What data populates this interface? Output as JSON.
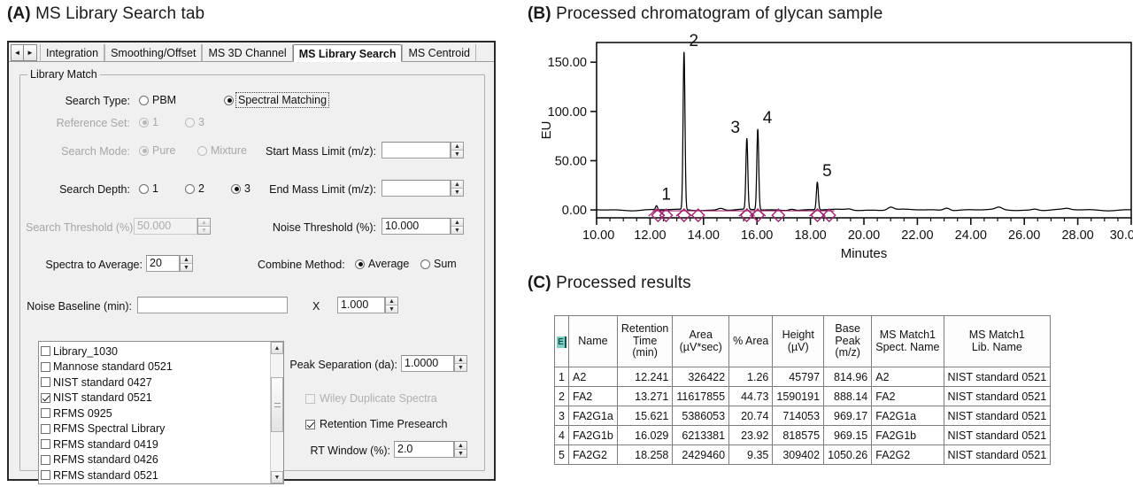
{
  "panels": {
    "a": {
      "tag": "(A)",
      "title": "MS Library Search tab"
    },
    "b": {
      "tag": "(B)",
      "title": "Processed chromatogram of glycan sample"
    },
    "c": {
      "tag": "(C)",
      "title": "Processed results"
    }
  },
  "dialog": {
    "scroll_left_icon": "◄",
    "scroll_right_icon": "►",
    "tabs": [
      {
        "label": "Integration",
        "active": false
      },
      {
        "label": "Smoothing/Offset",
        "active": false
      },
      {
        "label": "MS 3D Channel",
        "active": false
      },
      {
        "label": "MS Library Search",
        "active": true
      },
      {
        "label": "MS Centroid",
        "active": false
      }
    ],
    "groupbox_title": "Library Match",
    "fields": {
      "search_type_label": "Search Type:",
      "search_type_pbm": "PBM",
      "search_type_spectral": "Spectral Matching",
      "reference_set_label": "Reference Set:",
      "reference_set_1": "1",
      "reference_set_3": "3",
      "search_mode_label": "Search Mode:",
      "search_mode_pure": "Pure",
      "search_mode_mixture": "Mixture",
      "search_depth_label": "Search Depth:",
      "search_depth_1": "1",
      "search_depth_2": "2",
      "search_depth_3": "3",
      "search_threshold_label": "Search Threshold (%):",
      "search_threshold_value": "50.000",
      "start_mass_label": "Start Mass Limit (m/z):",
      "start_mass_value": "",
      "end_mass_label": "End Mass Limit (m/z):",
      "end_mass_value": "",
      "noise_threshold_label": "Noise Threshold (%):",
      "noise_threshold_value": "10.000",
      "spectra_average_label": "Spectra to Average:",
      "spectra_average_value": "20",
      "combine_method_label": "Combine Method:",
      "combine_average": "Average",
      "combine_sum": "Sum",
      "noise_baseline_label": "Noise Baseline (min):",
      "noise_baseline_value": "",
      "multiply_symbol": "X",
      "noise_baseline_factor": "1.000",
      "peak_separation_label": "Peak Separation (da):",
      "peak_separation_value": "1.0000",
      "wiley_duplicate_label": "Wiley Duplicate Spectra",
      "retention_presearch_label": "Retention Time Presearch",
      "rt_window_label": "RT Window (%):",
      "rt_window_value": "2.0",
      "spin_up_icon": "▲",
      "spin_down_icon": "▼"
    },
    "libraries": [
      {
        "label": "Library_1030",
        "checked": false
      },
      {
        "label": "Mannose standard 0521",
        "checked": false
      },
      {
        "label": "NIST standard 0427",
        "checked": false
      },
      {
        "label": "NIST standard 0521",
        "checked": true
      },
      {
        "label": "RFMS 0925",
        "checked": false
      },
      {
        "label": "RFMS Spectral Library",
        "checked": false
      },
      {
        "label": "RFMS standard 0419",
        "checked": false
      },
      {
        "label": "RFMS standard 0426",
        "checked": false
      },
      {
        "label": "RFMS standard 0521",
        "checked": false
      }
    ]
  },
  "chart_data": {
    "type": "line",
    "title": "Processed chromatogram of glycan sample",
    "xlabel": "Minutes",
    "ylabel": "EU",
    "xlim": [
      10.0,
      30.0
    ],
    "ylim": [
      -8,
      170
    ],
    "grid": false,
    "legend": "none",
    "xticks": [
      "10.00",
      "12.00",
      "14.00",
      "16.00",
      "18.00",
      "20.00",
      "22.00",
      "24.00",
      "26.00",
      "28.00",
      "30.00"
    ],
    "yticks": [
      "0.00",
      "50.00",
      "100.00",
      "150.00"
    ],
    "peak_marker_color": "#a0246e",
    "trace_color": "#000000",
    "labeled_peaks": [
      {
        "label": "1",
        "x": 12.241,
        "y": 4.0
      },
      {
        "label": "2",
        "x": 13.271,
        "y": 160.0
      },
      {
        "label": "3",
        "x": 15.621,
        "y": 72.0
      },
      {
        "label": "4",
        "x": 16.029,
        "y": 82.0
      },
      {
        "label": "5",
        "x": 18.258,
        "y": 28.0
      }
    ],
    "marker_x": [
      12.3,
      12.6,
      13.27,
      13.8,
      15.62,
      16.03,
      16.8,
      18.26,
      18.7
    ],
    "minor_peaks": [
      {
        "x": 14.65,
        "y": 2.0
      },
      {
        "x": 17.3,
        "y": 1.5
      },
      {
        "x": 19.45,
        "y": 1.2
      },
      {
        "x": 21.0,
        "y": 3.0
      },
      {
        "x": 23.1,
        "y": 2.6
      },
      {
        "x": 25.05,
        "y": 2.2
      },
      {
        "x": 26.4,
        "y": 1.2
      },
      {
        "x": 27.6,
        "y": 1.0
      }
    ]
  },
  "results_table": {
    "corner_icon": "E",
    "columns": [
      {
        "key": "name",
        "header": "Name",
        "align": "txt"
      },
      {
        "key": "rt",
        "header": "Retention\nTime\n(min)",
        "align": "num"
      },
      {
        "key": "area",
        "header": "Area\n(µV*sec)",
        "align": "num"
      },
      {
        "key": "parea",
        "header": "% Area",
        "align": "num"
      },
      {
        "key": "height",
        "header": "Height\n(µV)",
        "align": "num"
      },
      {
        "key": "basepk",
        "header": "Base\nPeak\n(m/z)",
        "align": "num"
      },
      {
        "key": "spect",
        "header": "MS Match1\nSpect. Name",
        "align": "txt"
      },
      {
        "key": "lib",
        "header": "MS Match1\nLib. Name",
        "align": "txt"
      }
    ],
    "rows": [
      {
        "no": "1",
        "name": "A2",
        "rt": "12.241",
        "area": "326422",
        "parea": "1.26",
        "height": "45797",
        "basepk": "814.96",
        "spect": "A2",
        "lib": "NIST standard 0521"
      },
      {
        "no": "2",
        "name": "FA2",
        "rt": "13.271",
        "area": "11617855",
        "parea": "44.73",
        "height": "1590191",
        "basepk": "888.14",
        "spect": "FA2",
        "lib": "NIST standard 0521"
      },
      {
        "no": "3",
        "name": "FA2G1a",
        "rt": "15.621",
        "area": "5386053",
        "parea": "20.74",
        "height": "714053",
        "basepk": "969.17",
        "spect": "FA2G1a",
        "lib": "NIST standard 0521"
      },
      {
        "no": "4",
        "name": "FA2G1b",
        "rt": "16.029",
        "area": "6213381",
        "parea": "23.92",
        "height": "818575",
        "basepk": "969.15",
        "spect": "FA2G1b",
        "lib": "NIST standard 0521"
      },
      {
        "no": "5",
        "name": "FA2G2",
        "rt": "18.258",
        "area": "2429460",
        "parea": "9.35",
        "height": "309402",
        "basepk": "1050.26",
        "spect": "FA2G2",
        "lib": "NIST standard 0521"
      }
    ]
  }
}
